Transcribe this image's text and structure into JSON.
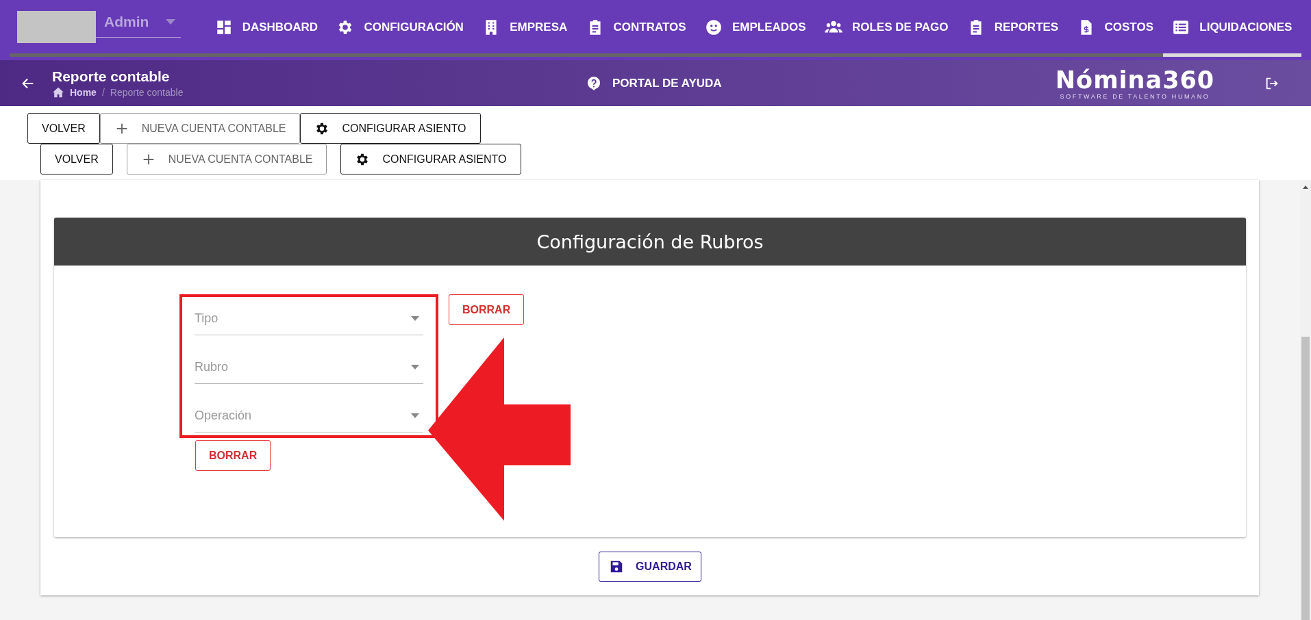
{
  "nav": {
    "user_select": {
      "value": "Admin"
    },
    "items": [
      {
        "label": "DASHBOARD",
        "selected": false
      },
      {
        "label": "CONFIGURACIÓN",
        "selected": false
      },
      {
        "label": "EMPRESA",
        "selected": false
      },
      {
        "label": "CONTRATOS",
        "selected": false
      },
      {
        "label": "EMPLEADOS",
        "selected": false
      },
      {
        "label": "ROLES DE PAGO",
        "selected": false
      },
      {
        "label": "REPORTES",
        "selected": false
      },
      {
        "label": "COSTOS",
        "selected": false
      },
      {
        "label": "LIQUIDACIONES",
        "selected": true
      }
    ]
  },
  "header": {
    "title": "Reporte contable",
    "breadcrumb": [
      {
        "label": "Home"
      },
      {
        "label": "Reporte contable"
      }
    ],
    "breadcrumb_separator": "/",
    "help_link": "PORTAL DE AYUDA",
    "logo": {
      "name": "Nómina360",
      "tagline": "SOFTWARE DE TALENTO HUMANO"
    }
  },
  "toolbars": [
    {
      "buttons": [
        {
          "label": "VOLVER",
          "kind": "plain",
          "disabled": false
        },
        {
          "label": "NUEVA CUENTA CONTABLE",
          "kind": "add",
          "disabled": true
        },
        {
          "label": "CONFIGURAR ASIENTO",
          "kind": "settings",
          "disabled": false
        }
      ]
    },
    {
      "buttons": [
        {
          "label": "VOLVER",
          "kind": "plain",
          "disabled": false
        },
        {
          "label": "NUEVA CUENTA CONTABLE",
          "kind": "add",
          "disabled": true
        },
        {
          "label": "CONFIGURAR ASIENTO",
          "kind": "settings",
          "disabled": false
        }
      ]
    }
  ],
  "panel": {
    "title": "Configuración de Rubros",
    "selects": [
      {
        "placeholder": "Tipo"
      },
      {
        "placeholder": "Rubro"
      },
      {
        "placeholder": "Operación"
      }
    ],
    "clear_buttons": [
      "BORRAR",
      "BORRAR"
    ]
  },
  "save_button": "GUARDAR"
}
